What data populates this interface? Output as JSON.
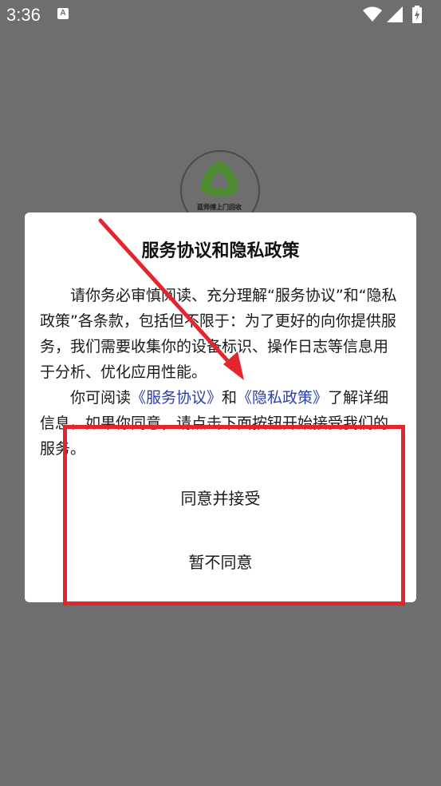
{
  "status_bar": {
    "time": "3:36",
    "notification_icon_letter": "A",
    "icons": [
      "wifi-icon",
      "cell-signal-icon",
      "battery-charging-icon"
    ]
  },
  "splash": {
    "logo_text": "蓝师傅上门回收",
    "logo_color": "#4e8a2f"
  },
  "dialog": {
    "title": "服务协议和隐私政策",
    "paragraph1": "请你务必审慎阅读、充分理解“服务协议”和“隐私政策”各条款，包括但不限于：为了更好的向你提供服务，我们需要收集你的设备标识、操作日志等信息用于分析、优化应用性能。",
    "paragraph2_prefix": "你可阅读",
    "link_service": "《服务协议》",
    "paragraph2_and": "和",
    "link_privacy": "《隐私政策》",
    "paragraph2_suffix": "了解详细信息。如果你同意，请点击下面按钮开始接受我们的服务。",
    "accept_label": "同意并接受",
    "decline_label": "暂不同意"
  },
  "colors": {
    "overlay_bg": "#6e6e6e",
    "link": "#2a3fa8",
    "annotation_red": "#e3262d"
  }
}
